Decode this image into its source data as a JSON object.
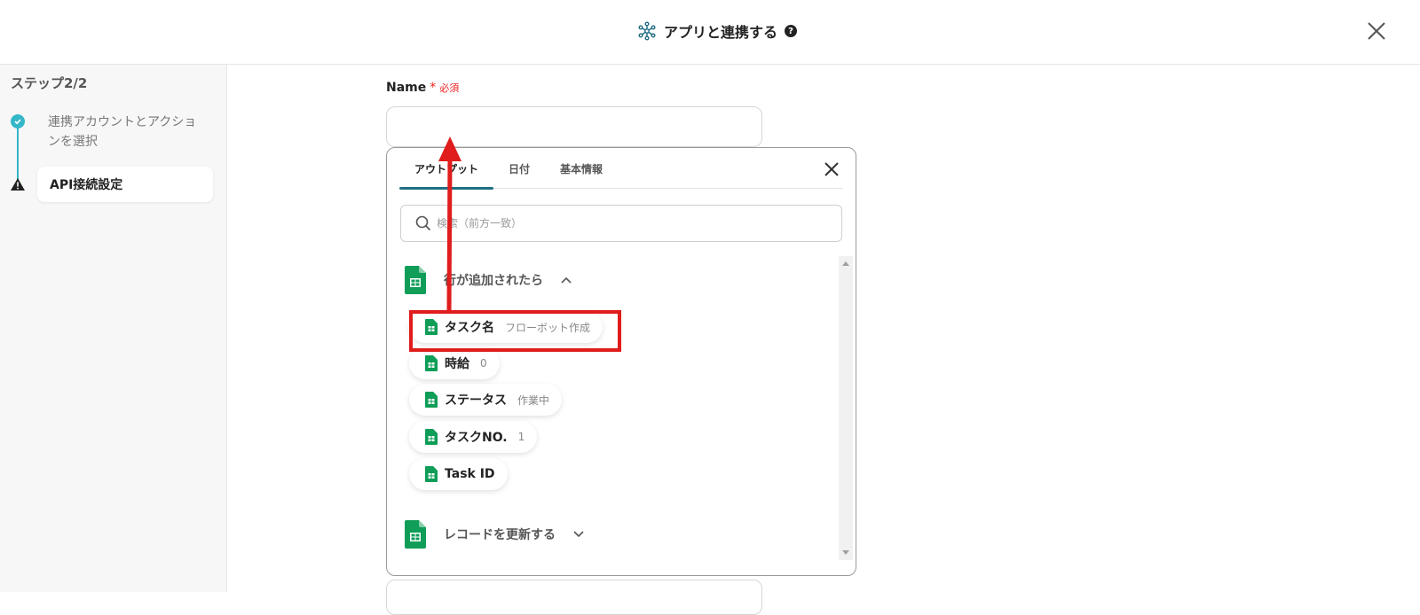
{
  "header": {
    "title": "アプリと連携する",
    "help": "?"
  },
  "sidebar": {
    "step_label": "ステップ2/2",
    "steps": [
      {
        "label": "連携アカウントとアクションを選択",
        "status": "done"
      },
      {
        "label": "API接続設定",
        "status": "warning"
      }
    ]
  },
  "form": {
    "field_label": "Name",
    "required_mark": "*",
    "required_text": "必須",
    "input_value": ""
  },
  "popup": {
    "tabs": [
      {
        "label": "アウトプット",
        "active": true
      },
      {
        "label": "日付",
        "active": false
      },
      {
        "label": "基本情報",
        "active": false
      }
    ],
    "search_placeholder": "検索（前方一致）",
    "sections": [
      {
        "title": "行が追加されたら",
        "expanded": true,
        "items": [
          {
            "name": "タスク名",
            "value": "フローボット作成"
          },
          {
            "name": "時給",
            "value": "0"
          },
          {
            "name": "ステータス",
            "value": "作業中"
          },
          {
            "name": "タスクNO.",
            "value": "1"
          },
          {
            "name": "Task ID",
            "value": ""
          }
        ]
      },
      {
        "title": "レコードを更新する",
        "expanded": false,
        "items": []
      }
    ]
  },
  "colors": {
    "accent": "#34b7c9",
    "tab_underline": "#1f6e84",
    "annotation_red": "#e01c1c",
    "sheets_green": "#0f9d58"
  },
  "icons": {
    "header": "network-hub-icon",
    "close": "close-icon",
    "step_done": "check-circle-icon",
    "step_warning": "warning-triangle-icon",
    "search": "search-icon",
    "sheet": "google-sheets-icon"
  }
}
